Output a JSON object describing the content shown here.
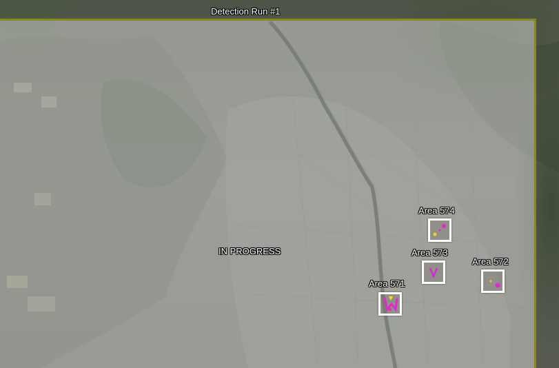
{
  "map": {
    "run_title": "Detection Run #1",
    "run_status": "IN PROGRESS",
    "overlay_border_color": "#8a8620",
    "areas": [
      {
        "label": "Area 574",
        "marker_colors": [
          "#e02bd0",
          "#e6d620"
        ]
      },
      {
        "label": "Area 573",
        "marker_colors": [
          "#d02bd6"
        ]
      },
      {
        "label": "Area 572",
        "marker_colors": [
          "#e02bd0",
          "#e6d620"
        ]
      },
      {
        "label": "Area 571",
        "marker_colors": [
          "#e02bd0",
          "#f2e01c"
        ]
      }
    ]
  }
}
